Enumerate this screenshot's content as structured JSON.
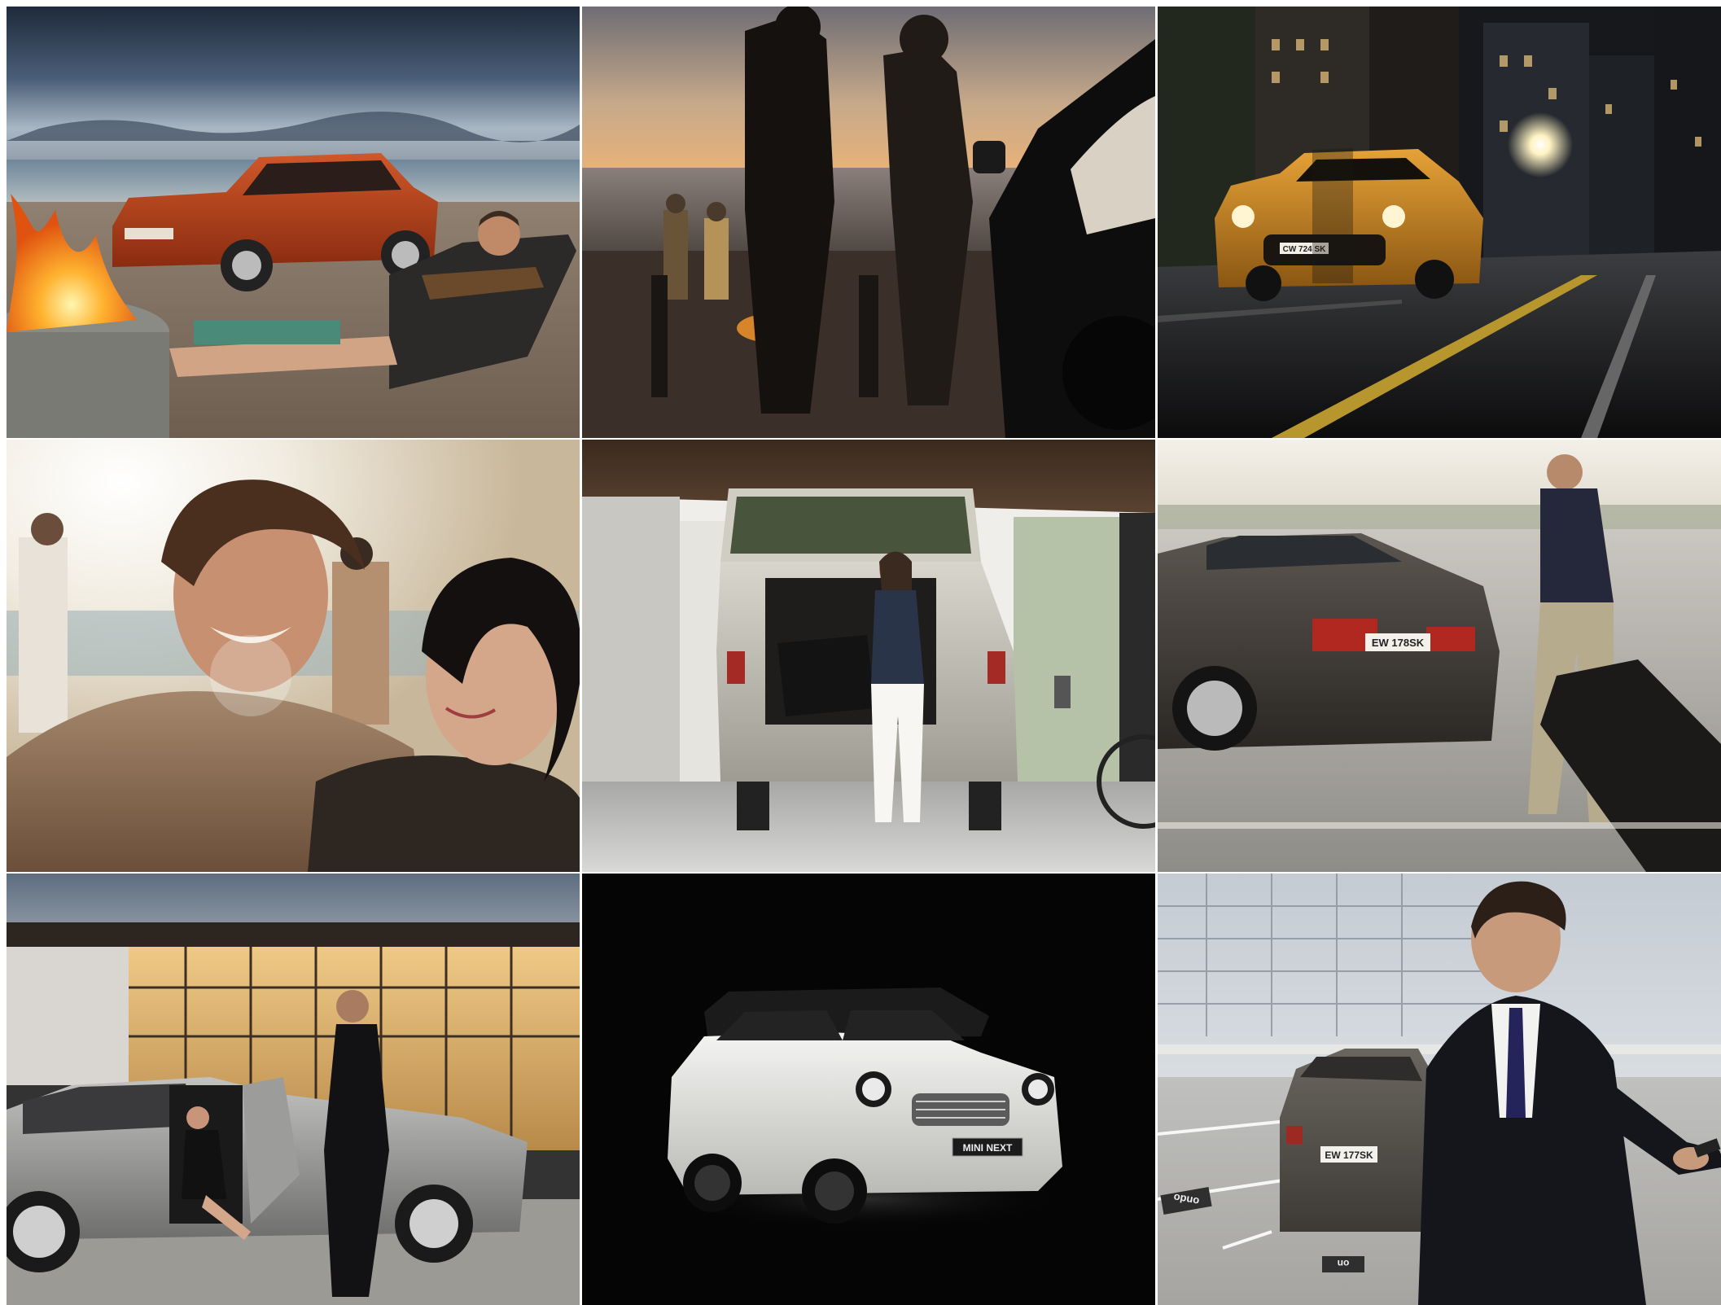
{
  "collage": {
    "rows": 3,
    "columns": 3,
    "tiles": [
      {
        "subject": "orange SUV on beach with bonfire and man playing guitar"
      },
      {
        "subject": "couple silhouetted walking toward beach bonfire at sunset beside convertible"
      },
      {
        "subject": "yellow hatchback driving on city street at night"
      },
      {
        "subject": "smiling couple in warm sunlight"
      },
      {
        "subject": "woman loading bag into open SUV tailgate under carport"
      },
      {
        "subject": "man with golf bag beside dark sedan in parking lot"
      },
      {
        "subject": "silver sedan with open door, chauffeur and woman, glass building"
      },
      {
        "subject": "white crossover on black background",
        "badge": "MINI NEXT"
      },
      {
        "subject": "businessman checking phone beside estate car in parking garage"
      }
    ],
    "plates": {
      "tile3": "CW 724 SK",
      "tile6": "EW 178SK",
      "tile9": "EW 177SK"
    },
    "ground_markings": {
      "tile9_left": "ondo",
      "tile9_right": "on"
    }
  }
}
